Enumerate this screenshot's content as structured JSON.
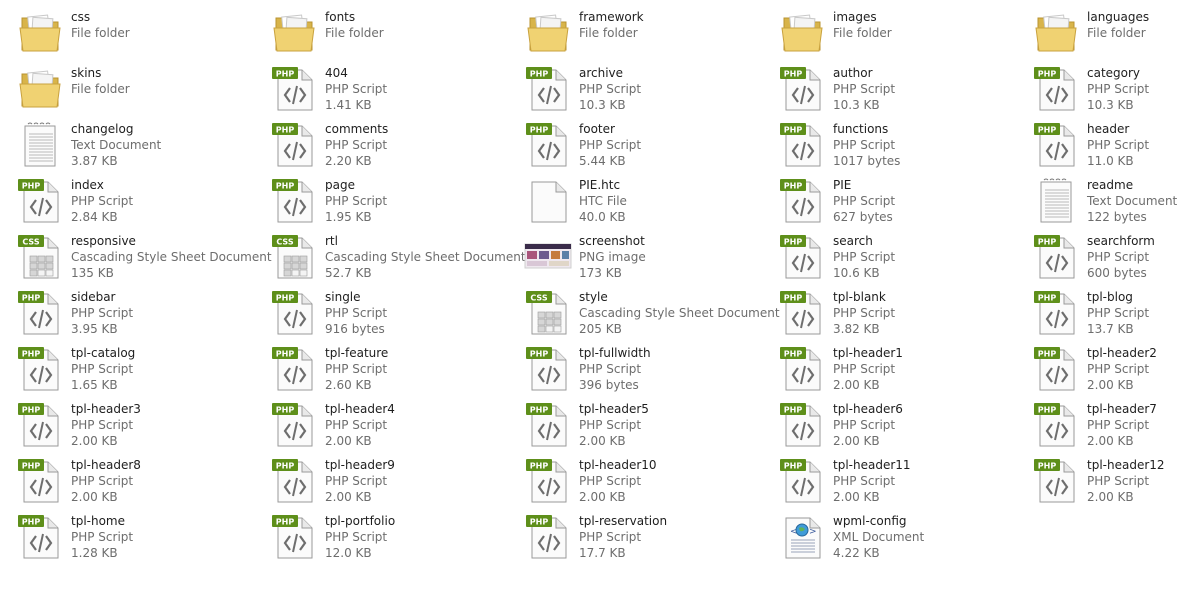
{
  "items": [
    {
      "name": "css",
      "type": "File folder",
      "size": "",
      "icon": "folder-icon"
    },
    {
      "name": "fonts",
      "type": "File folder",
      "size": "",
      "icon": "folder-icon"
    },
    {
      "name": "framework",
      "type": "File folder",
      "size": "",
      "icon": "folder-icon"
    },
    {
      "name": "images",
      "type": "File folder",
      "size": "",
      "icon": "folder-icon"
    },
    {
      "name": "languages",
      "type": "File folder",
      "size": "",
      "icon": "folder-icon"
    },
    {
      "name": "skins",
      "type": "File folder",
      "size": "",
      "icon": "folder-icon"
    },
    {
      "name": "404",
      "type": "PHP Script",
      "size": "1.41 KB",
      "icon": "php-file-icon"
    },
    {
      "name": "archive",
      "type": "PHP Script",
      "size": "10.3 KB",
      "icon": "php-file-icon"
    },
    {
      "name": "author",
      "type": "PHP Script",
      "size": "10.3 KB",
      "icon": "php-file-icon"
    },
    {
      "name": "category",
      "type": "PHP Script",
      "size": "10.3 KB",
      "icon": "php-file-icon"
    },
    {
      "name": "changelog",
      "type": "Text Document",
      "size": "3.87 KB",
      "icon": "text-file-icon"
    },
    {
      "name": "comments",
      "type": "PHP Script",
      "size": "2.20 KB",
      "icon": "php-file-icon"
    },
    {
      "name": "footer",
      "type": "PHP Script",
      "size": "5.44 KB",
      "icon": "php-file-icon"
    },
    {
      "name": "functions",
      "type": "PHP Script",
      "size": "1017 bytes",
      "icon": "php-file-icon"
    },
    {
      "name": "header",
      "type": "PHP Script",
      "size": "11.0 KB",
      "icon": "php-file-icon"
    },
    {
      "name": "index",
      "type": "PHP Script",
      "size": "2.84 KB",
      "icon": "php-file-icon"
    },
    {
      "name": "page",
      "type": "PHP Script",
      "size": "1.95 KB",
      "icon": "php-file-icon"
    },
    {
      "name": "PIE.htc",
      "type": "HTC File",
      "size": "40.0 KB",
      "icon": "blank-file-icon"
    },
    {
      "name": "PIE",
      "type": "PHP Script",
      "size": "627 bytes",
      "icon": "php-file-icon"
    },
    {
      "name": "readme",
      "type": "Text Document",
      "size": "122 bytes",
      "icon": "text-file-icon"
    },
    {
      "name": "responsive",
      "type": "Cascading Style Sheet Document",
      "size": "135 KB",
      "icon": "css-file-icon"
    },
    {
      "name": "rtl",
      "type": "Cascading Style Sheet Document",
      "size": "52.7 KB",
      "icon": "css-file-icon"
    },
    {
      "name": "screenshot",
      "type": "PNG image",
      "size": "173 KB",
      "icon": "image-thumbnail-icon"
    },
    {
      "name": "search",
      "type": "PHP Script",
      "size": "10.6 KB",
      "icon": "php-file-icon"
    },
    {
      "name": "searchform",
      "type": "PHP Script",
      "size": "600 bytes",
      "icon": "php-file-icon"
    },
    {
      "name": "sidebar",
      "type": "PHP Script",
      "size": "3.95 KB",
      "icon": "php-file-icon"
    },
    {
      "name": "single",
      "type": "PHP Script",
      "size": "916 bytes",
      "icon": "php-file-icon"
    },
    {
      "name": "style",
      "type": "Cascading Style Sheet Document",
      "size": "205 KB",
      "icon": "css-file-icon"
    },
    {
      "name": "tpl-blank",
      "type": "PHP Script",
      "size": "3.82 KB",
      "icon": "php-file-icon"
    },
    {
      "name": "tpl-blog",
      "type": "PHP Script",
      "size": "13.7 KB",
      "icon": "php-file-icon"
    },
    {
      "name": "tpl-catalog",
      "type": "PHP Script",
      "size": "1.65 KB",
      "icon": "php-file-icon"
    },
    {
      "name": "tpl-feature",
      "type": "PHP Script",
      "size": "2.60 KB",
      "icon": "php-file-icon"
    },
    {
      "name": "tpl-fullwidth",
      "type": "PHP Script",
      "size": "396 bytes",
      "icon": "php-file-icon"
    },
    {
      "name": "tpl-header1",
      "type": "PHP Script",
      "size": "2.00 KB",
      "icon": "php-file-icon"
    },
    {
      "name": "tpl-header2",
      "type": "PHP Script",
      "size": "2.00 KB",
      "icon": "php-file-icon"
    },
    {
      "name": "tpl-header3",
      "type": "PHP Script",
      "size": "2.00 KB",
      "icon": "php-file-icon"
    },
    {
      "name": "tpl-header4",
      "type": "PHP Script",
      "size": "2.00 KB",
      "icon": "php-file-icon"
    },
    {
      "name": "tpl-header5",
      "type": "PHP Script",
      "size": "2.00 KB",
      "icon": "php-file-icon"
    },
    {
      "name": "tpl-header6",
      "type": "PHP Script",
      "size": "2.00 KB",
      "icon": "php-file-icon"
    },
    {
      "name": "tpl-header7",
      "type": "PHP Script",
      "size": "2.00 KB",
      "icon": "php-file-icon"
    },
    {
      "name": "tpl-header8",
      "type": "PHP Script",
      "size": "2.00 KB",
      "icon": "php-file-icon"
    },
    {
      "name": "tpl-header9",
      "type": "PHP Script",
      "size": "2.00 KB",
      "icon": "php-file-icon"
    },
    {
      "name": "tpl-header10",
      "type": "PHP Script",
      "size": "2.00 KB",
      "icon": "php-file-icon"
    },
    {
      "name": "tpl-header11",
      "type": "PHP Script",
      "size": "2.00 KB",
      "icon": "php-file-icon"
    },
    {
      "name": "tpl-header12",
      "type": "PHP Script",
      "size": "2.00 KB",
      "icon": "php-file-icon"
    },
    {
      "name": "tpl-home",
      "type": "PHP Script",
      "size": "1.28 KB",
      "icon": "php-file-icon"
    },
    {
      "name": "tpl-portfolio",
      "type": "PHP Script",
      "size": "12.0 KB",
      "icon": "php-file-icon"
    },
    {
      "name": "tpl-reservation",
      "type": "PHP Script",
      "size": "17.7 KB",
      "icon": "php-file-icon"
    },
    {
      "name": "wpml-config",
      "type": "XML Document",
      "size": "4.22 KB",
      "icon": "xml-file-icon"
    }
  ],
  "colors": {
    "php_badge": "#5e8f1a",
    "css_badge": "#5e8f1a",
    "folder": "#e8c860",
    "name_text": "#1e1e1e",
    "meta_text": "#6d6d6d"
  },
  "badges": {
    "php": "PHP",
    "css": "CSS"
  }
}
